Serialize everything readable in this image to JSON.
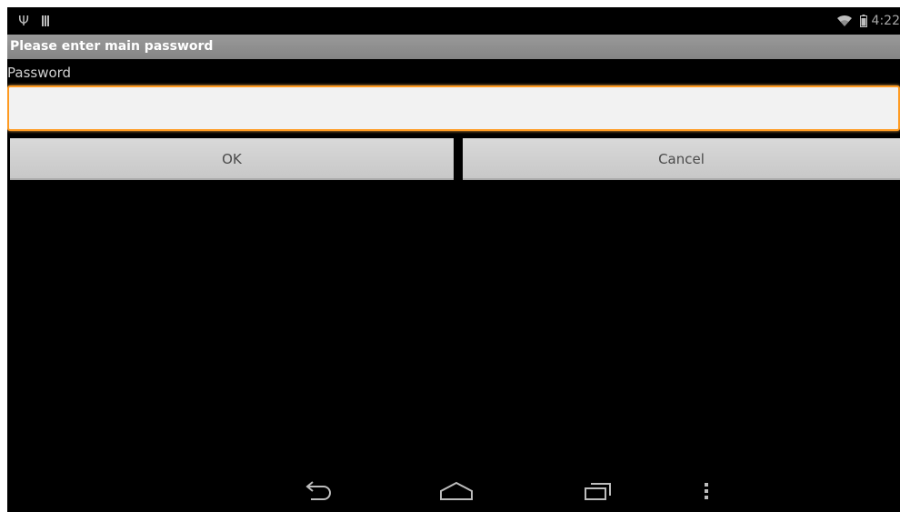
{
  "status_bar": {
    "left_icons": [
      "usb-icon",
      "storage-icon"
    ],
    "right_icons": [
      "wifi-icon",
      "battery-icon"
    ],
    "clock": "4:22"
  },
  "dialog": {
    "title": "Please enter main password",
    "field_label": "Password",
    "field_value": "",
    "field_placeholder": "",
    "ok_label": "OK",
    "cancel_label": "Cancel"
  },
  "nav_bar": {
    "icons": [
      "back-icon",
      "home-icon",
      "recents-icon",
      "menu-icon"
    ]
  },
  "colors": {
    "background": "#000000",
    "title_bar": "#8e8e8e",
    "focus_accent": "#ff9b22",
    "button_face": "#d0d0d0",
    "icon_gray": "#bdbdbd"
  }
}
